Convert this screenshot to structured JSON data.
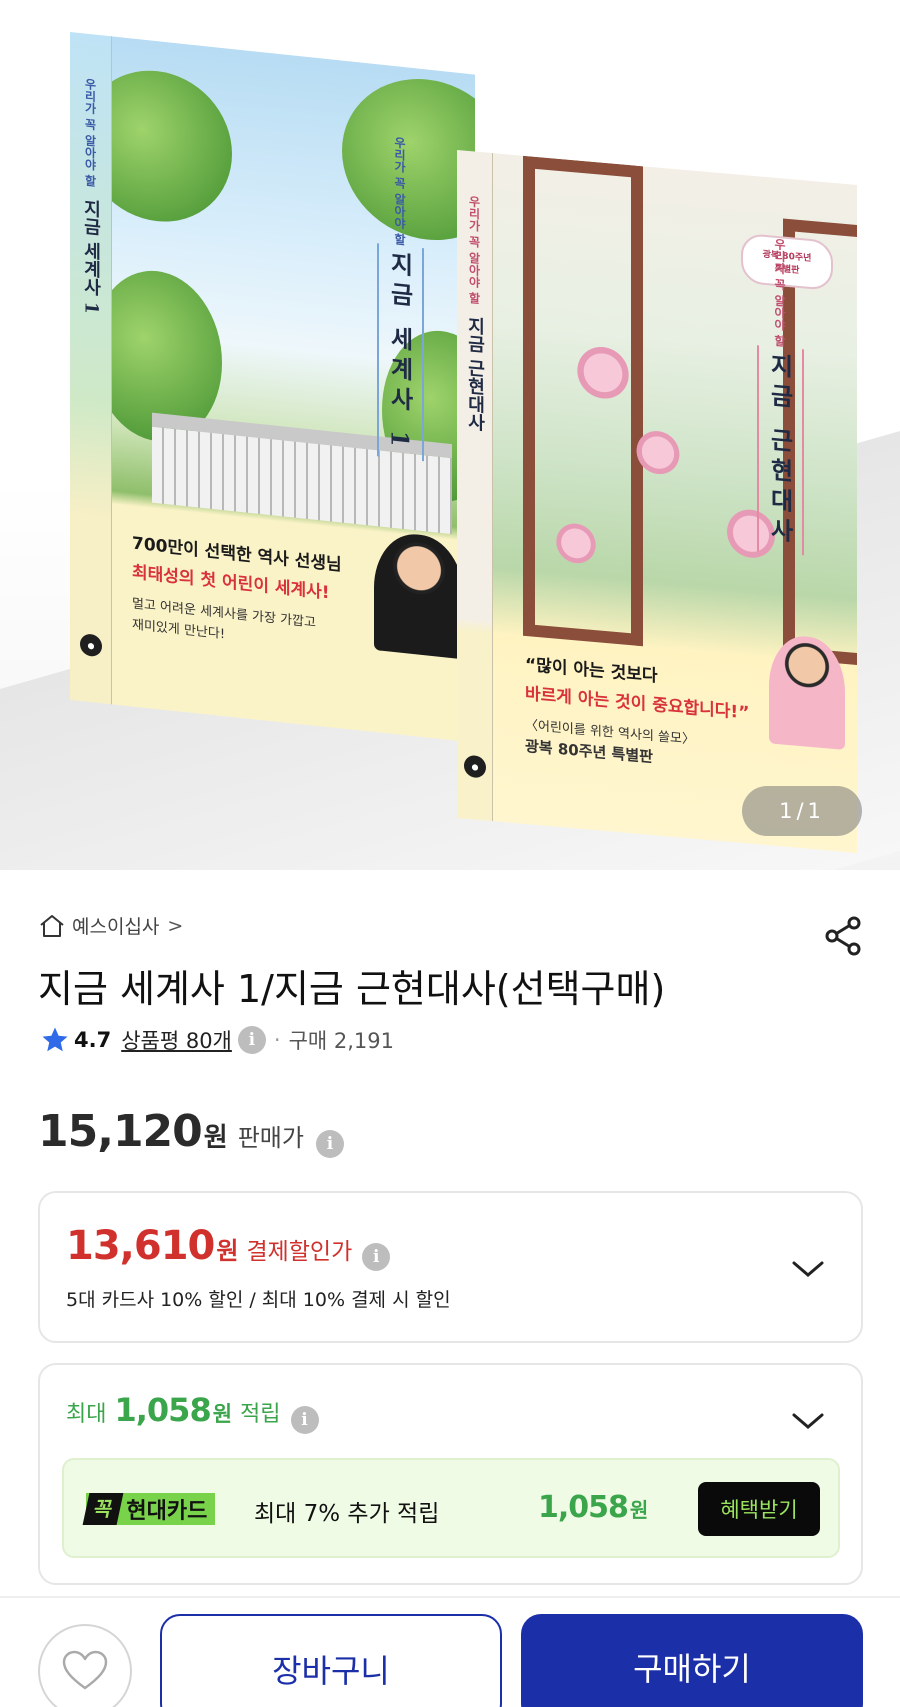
{
  "hero": {
    "pager": {
      "current": "1",
      "separator": "/",
      "total": "1"
    },
    "book1": {
      "spine_pre": "우리가 꼭 알아야 할",
      "spine_title": "지금 세계사 1",
      "cover_pre": "우리가 꼭 알아야 할",
      "cover_title": "지금 세계사 1",
      "promo_line1": "700만이 선택한 역사 선생님",
      "promo_line2": "최태성의 첫 어린이 세계사!",
      "promo_line3": "멀고 어려운 세계사를 가장 가깝고",
      "promo_line4": "재미있게 만난다!"
    },
    "book2": {
      "spine_pre": "우리가 꼭 알아야 할",
      "spine_title": "지금 근현대사",
      "cover_pre": "우리가 꼭 알아야 할",
      "cover_title": "지금 근현대사",
      "badge_line1": "광복 80주년",
      "badge_line2": "특별판",
      "promo_line1": "“많이 아는 것보다",
      "promo_line2": "바르게 아는 것이 중요합니다!”",
      "promo_line3": "〈어린이를 위한 역사의 쓸모〉",
      "promo_line4": "광복 80주년 특별판"
    }
  },
  "breadcrumb": {
    "label": "예스이십사",
    "chevron": ">"
  },
  "product": {
    "title": "지금 세계사 1/지금 근현대사(선택구매)",
    "rating": "4.7",
    "reviews": "상품평 80개",
    "purchase_count": "구매 2,191"
  },
  "price": {
    "amount": "15,120",
    "unit": "원",
    "label": "판매가"
  },
  "discount": {
    "amount": "13,610",
    "unit": "원",
    "label": "결제할인가",
    "description": "5대 카드사 10% 할인 / 최대 10% 결제 시 할인"
  },
  "points": {
    "prefix": "최대",
    "amount": "1,058",
    "unit": "원",
    "suffix": "적립",
    "card_promo": {
      "badge": "꼭",
      "card_name": "현대카드",
      "description": "최대 7% 추가 적립",
      "amount": "1,058",
      "unit": "원",
      "cta": "혜택받기"
    }
  },
  "bottom_bar": {
    "cart_label": "장바구니",
    "buy_label": "구매하기"
  },
  "icons": {
    "home": "home-icon",
    "share": "share-icon",
    "star": "star-icon",
    "info": "info-icon",
    "chevron_down": "chevron-down-icon",
    "heart": "heart-icon"
  },
  "colors": {
    "brand_blue": "#1b2fa8",
    "discount_red": "#d0312d",
    "points_green": "#3aa54a",
    "star_blue": "#2f6be8"
  }
}
